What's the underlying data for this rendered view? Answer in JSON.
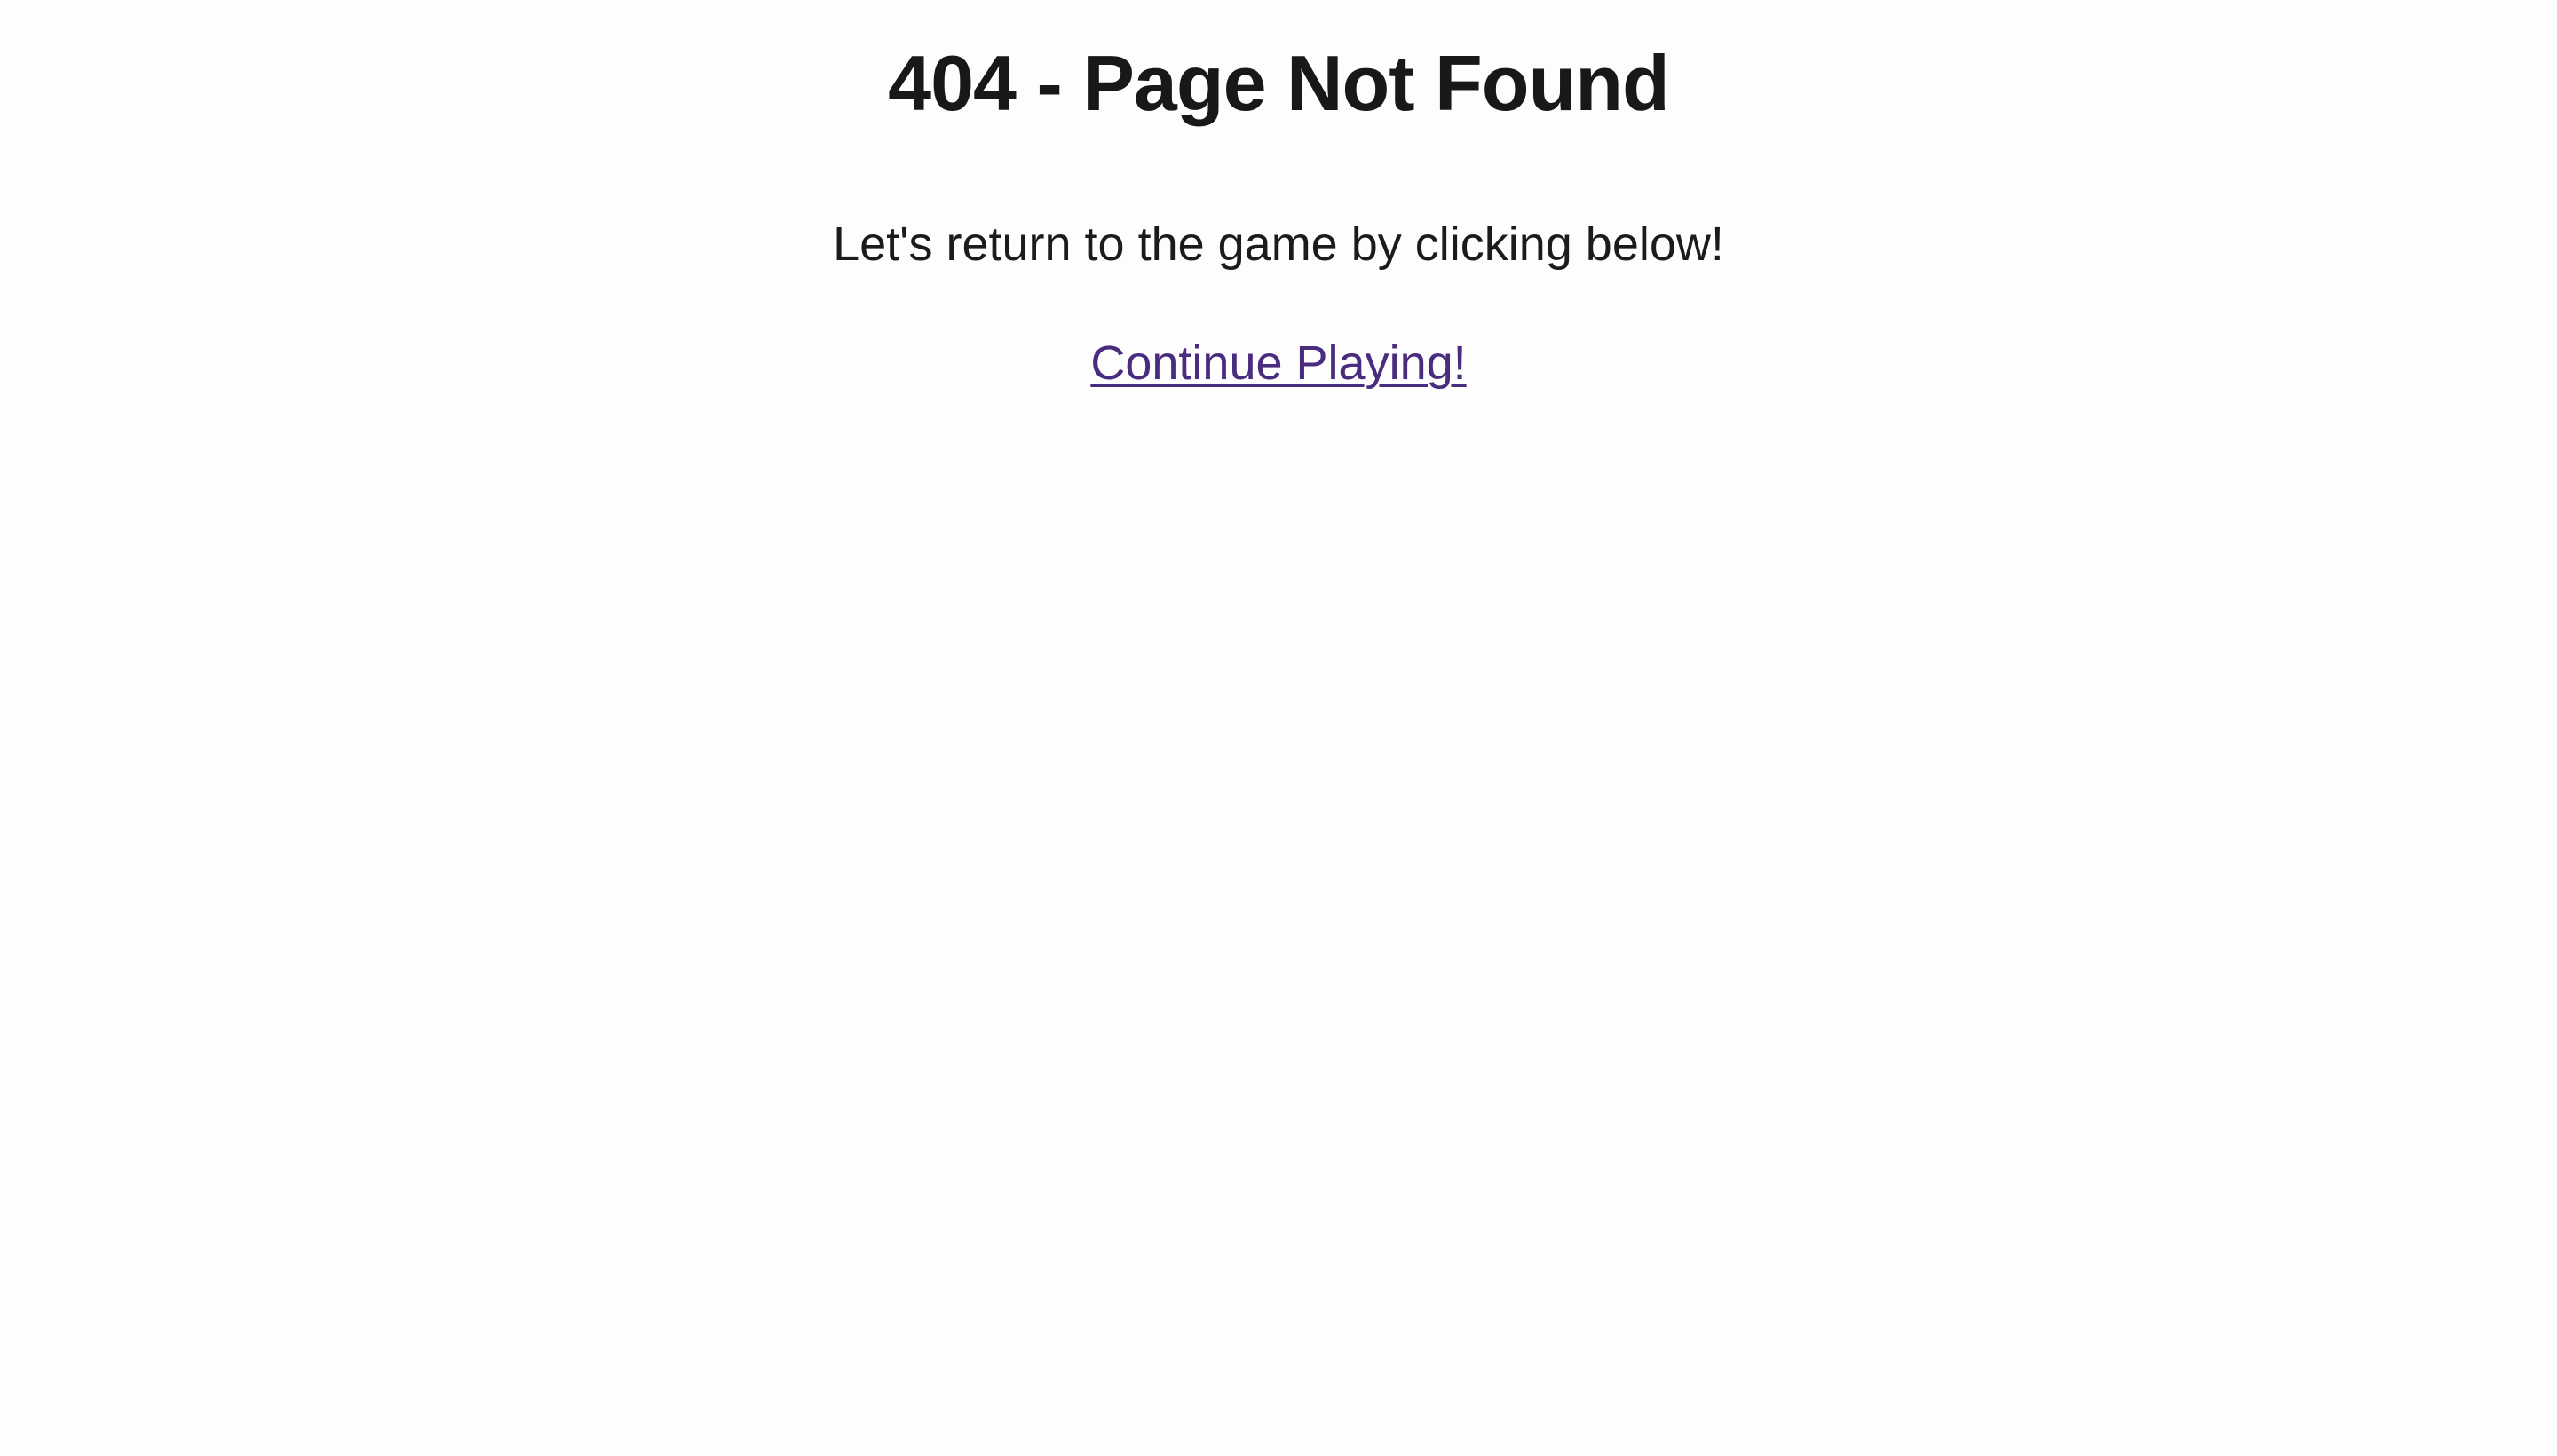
{
  "page": {
    "title": "404 - Page Not Found",
    "message": "Let's return to the game by clicking below!",
    "link_label": "Continue Playing!"
  },
  "colors": {
    "background": "#fdfdfd",
    "text": "#1b1b1b",
    "link": "#4a2c7e"
  }
}
